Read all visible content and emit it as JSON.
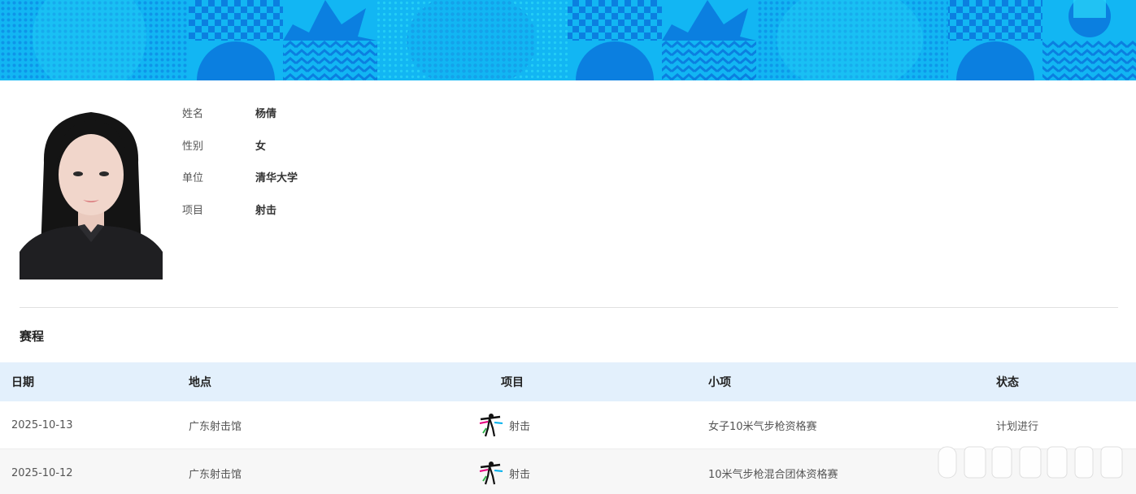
{
  "banner": {
    "colors": {
      "base": "#0aa8ee",
      "dark": "#0b7fe0",
      "light": "#27d3f7"
    }
  },
  "profile": {
    "photo_alt": "athlete-photo",
    "fields": [
      {
        "label": "姓名",
        "value": "杨倩"
      },
      {
        "label": "性别",
        "value": "女"
      },
      {
        "label": "单位",
        "value": "清华大学"
      },
      {
        "label": "项目",
        "value": "射击"
      }
    ]
  },
  "schedule": {
    "title": "赛程",
    "columns": {
      "date": "日期",
      "venue": "地点",
      "event": "项目",
      "sub_event": "小项",
      "status": "状态"
    },
    "rows": [
      {
        "date": "2025-10-13",
        "venue": "广东射击馆",
        "event": "射击",
        "event_icon": "shooting-icon",
        "sub_event": "女子10米气步枪资格赛",
        "status": "计划进行"
      },
      {
        "date": "2025-10-12",
        "venue": "广东射击馆",
        "event": "射击",
        "event_icon": "shooting-icon",
        "sub_event": "10米气步枪混合团体资格赛",
        "status": ""
      }
    ]
  },
  "theme": {
    "header_bg": "#e3f0fc",
    "alt_row_bg": "#f7f7f7"
  }
}
